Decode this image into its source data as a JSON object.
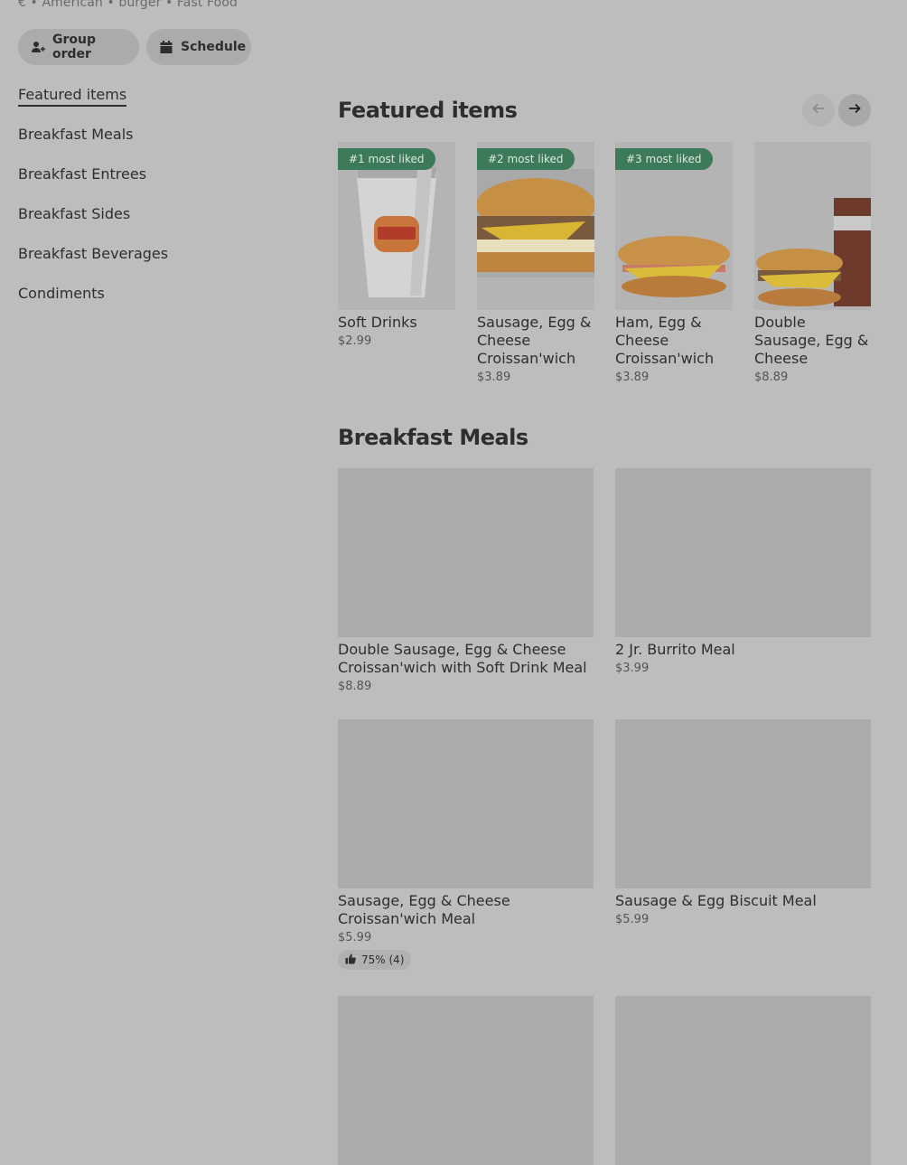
{
  "store": {
    "meta": "€ • American • burger • Fast Food"
  },
  "actions": {
    "group_order": "Group order",
    "schedule": "Schedule"
  },
  "sidebar": {
    "items": [
      {
        "label": "Featured items"
      },
      {
        "label": "Breakfast Meals"
      },
      {
        "label": "Breakfast Entrees"
      },
      {
        "label": "Breakfast Sides"
      },
      {
        "label": "Breakfast Beverages"
      },
      {
        "label": "Condiments"
      }
    ]
  },
  "featured": {
    "title": "Featured items",
    "items": [
      {
        "badge": "#1 most liked",
        "name": "Soft Drinks",
        "price": "$2.99",
        "image": "soft-drink-cup"
      },
      {
        "badge": "#2 most liked",
        "name": "Sausage, Egg & Cheese Croissan'wich",
        "price": "$3.89",
        "image": "croissant-sandwich"
      },
      {
        "badge": "#3 most liked",
        "name": "Ham, Egg & Cheese Croissan'wich",
        "price": "$3.89",
        "image": "croissant-sandwich"
      },
      {
        "badge": "",
        "name": "Double Sausage, Egg & Cheese Croissan'wich …",
        "price": "$8.89",
        "image": "meal-with-drink"
      }
    ]
  },
  "meals": {
    "title": "Breakfast Meals",
    "items": [
      {
        "name": "Double Sausage, Egg & Cheese Croissan'wich with Soft Drink Meal",
        "price": "$8.89",
        "rating": ""
      },
      {
        "name": "2 Jr. Burrito Meal",
        "price": "$3.99",
        "rating": ""
      },
      {
        "name": "Sausage, Egg & Cheese Croissan'wich Meal",
        "price": "$5.99",
        "rating": "75% (4)"
      },
      {
        "name": "Sausage & Egg Biscuit Meal",
        "price": "$5.99",
        "rating": ""
      }
    ]
  },
  "colors": {
    "badge_bg": "#3c7a5a",
    "overlay_bg": "#bdbdbd"
  },
  "icons": {
    "group_order": "person-add-icon",
    "schedule": "calendar-icon",
    "prev": "arrow-left-icon",
    "next": "arrow-right-icon",
    "rating": "thumbs-up-icon"
  }
}
